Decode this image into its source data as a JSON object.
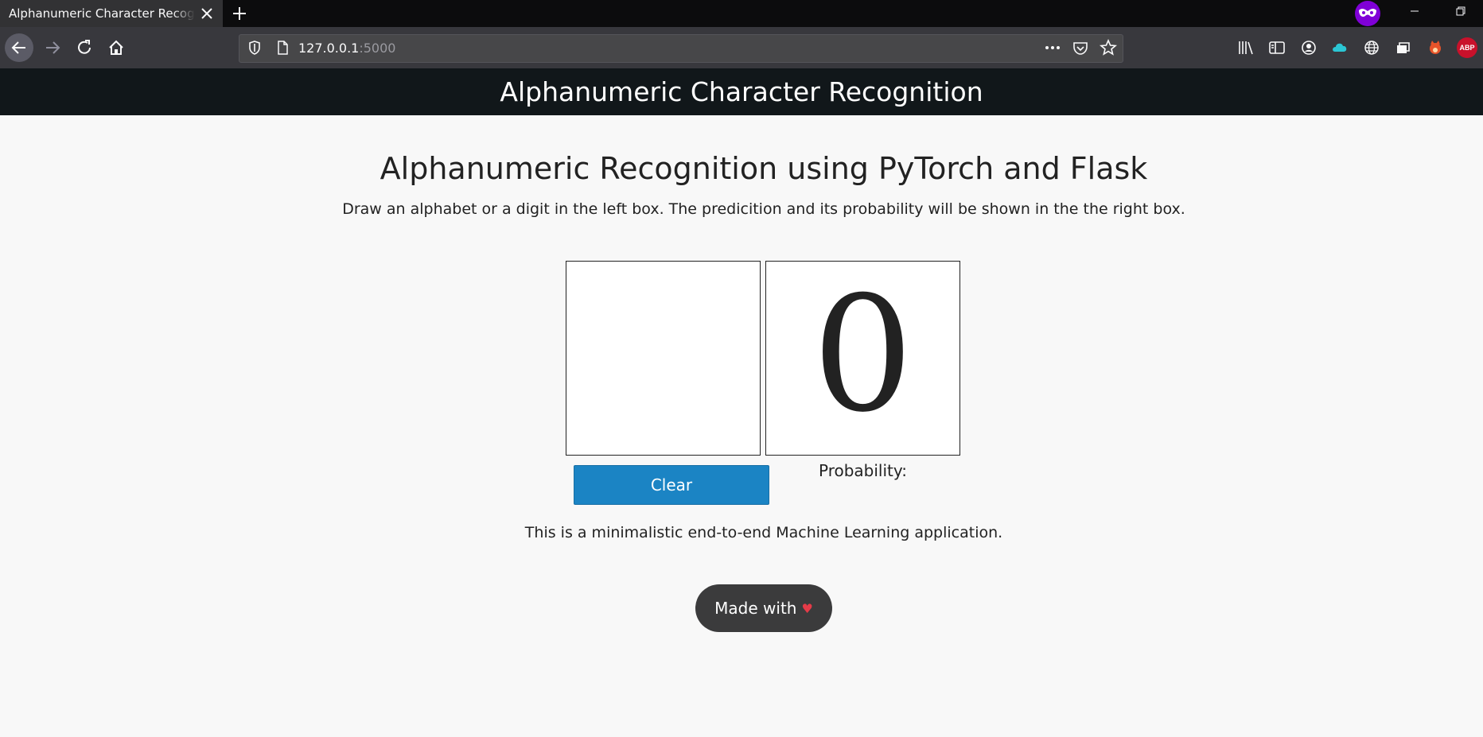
{
  "browser": {
    "tab_title": "Alphanumeric Character Recognition",
    "url_host": "127.0.0.1",
    "url_port": ":5000",
    "colors": {
      "tabbar": "#0c0c0d",
      "toolbar": "#38383d",
      "private_badge": "#8000d7"
    },
    "toolbar_icons": [
      "back-icon",
      "forward-icon",
      "reload-icon",
      "home-icon",
      "shield-icon",
      "page-icon",
      "more-icon",
      "pocket-icon",
      "bookmark-star-icon",
      "library-icon",
      "sidebar-icon",
      "account-icon",
      "cloud-icon",
      "globe-icon",
      "tabs-icon",
      "fox-extension-icon",
      "adblock-icon"
    ]
  },
  "header": {
    "title": "Alphanumeric Character Recognition"
  },
  "main": {
    "title": "Alphanumeric Recognition using PyTorch and Flask",
    "subtitle": "Draw an alphabet or a digit in the left box. The predicition and its probability will be shown in the the right box.",
    "prediction": "0",
    "clear_label": "Clear",
    "probability_label": "Probability:",
    "tagline": "This is a minimalistic end-to-end Machine Learning application.",
    "made_with_label": "Made with",
    "heart": "♥"
  },
  "adblock_label": "ABP"
}
